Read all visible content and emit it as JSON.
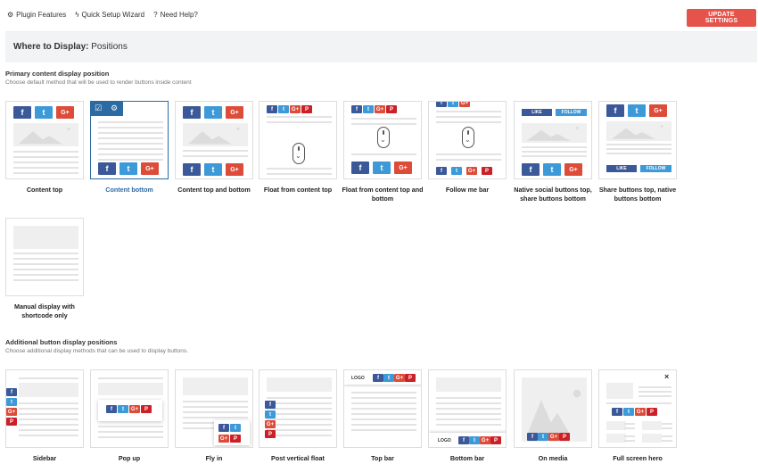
{
  "topnav": {
    "plugin_features": "Plugin Features",
    "quick_setup": "Quick Setup Wizard",
    "need_help": "Need Help?",
    "plugin_icon": "gear-icon",
    "wizard_icon": "bolt-icon",
    "help_icon": "question-icon"
  },
  "update_button": "UPDATE SETTINGS",
  "header": {
    "prefix": "Where to Display:",
    "title": "Positions"
  },
  "primary": {
    "title": "Primary content display position",
    "subtitle": "Choose default method that will be used to render buttons inside content",
    "selected": "Content bottom",
    "cards": [
      {
        "label": "Content top"
      },
      {
        "label": "Content bottom"
      },
      {
        "label": "Content top and bottom"
      },
      {
        "label": "Float from content top"
      },
      {
        "label": "Float from content top and bottom"
      },
      {
        "label": "Follow me bar"
      },
      {
        "label": "Native social buttons top, share buttons bottom"
      },
      {
        "label": "Share buttons top, native buttons bottom"
      },
      {
        "label": "Manual display with shortcode only"
      }
    ]
  },
  "additional": {
    "title": "Additional button display positions",
    "subtitle": "Choose additional display methods that can be used to display buttons.",
    "cards": [
      {
        "label": "Sidebar"
      },
      {
        "label": "Pop up"
      },
      {
        "label": "Fly in"
      },
      {
        "label": "Post vertical float"
      },
      {
        "label": "Top bar"
      },
      {
        "label": "Bottom bar"
      },
      {
        "label": "On media"
      },
      {
        "label": "Full screen hero"
      }
    ]
  },
  "glyphs": {
    "facebook": "f",
    "twitter": "t",
    "gplus": "G+",
    "pinterest": "P",
    "like": "LIKE",
    "follow": "FOLLOW",
    "logo": "LOGO",
    "close": "×",
    "checkbox_icon": "☑",
    "settings_icon": "⚙"
  },
  "colors": {
    "facebook": "#3b5998",
    "twitter": "#3d9ad8",
    "gplus": "#dd4b39",
    "pinterest": "#cb2027",
    "update_button": "#e5534b",
    "selected": "#2b6aa3"
  }
}
